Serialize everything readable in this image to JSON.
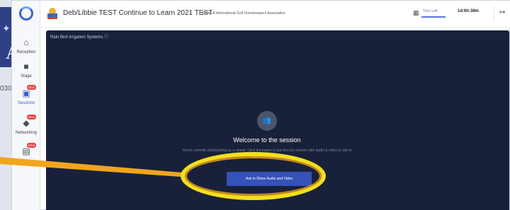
{
  "background": {
    "partial_number": "030"
  },
  "sidebar": {
    "items": [
      {
        "label": "Reception",
        "icon": "home-icon",
        "glyph": "⌂"
      },
      {
        "label": "Stage",
        "icon": "video-icon",
        "glyph": "■"
      },
      {
        "label": "Sessions",
        "icon": "sessions-icon",
        "glyph": "▣",
        "badge": "NEW"
      },
      {
        "label": "Networking",
        "icon": "networking-icon",
        "glyph": "◆",
        "badge": "NEW"
      },
      {
        "label": "",
        "icon": "expo-icon",
        "glyph": "▤",
        "badge": "NEW"
      }
    ]
  },
  "header": {
    "event_title": "Deb/Libbie TEST Continue to Learn 2021 TEST",
    "org_name": "British & International Golf Greenkeepers Association",
    "time_left_label": "Time Left",
    "time_left_value": "1d:6h:38m"
  },
  "stage": {
    "session_name": "Rain Bird Irrigation Systems",
    "welcome_title": "Welcome to the session",
    "welcome_desc": "You're currently participating as a viewer. Click the button to join the live session with audio & video or ask to share members here.",
    "ask_button": "Ask to Share Audio and Video"
  },
  "colors": {
    "stage_bg": "#19213a",
    "button": "#3552b8",
    "highlight_ring": "#f3df1c",
    "arrow": "#f2a51c"
  }
}
